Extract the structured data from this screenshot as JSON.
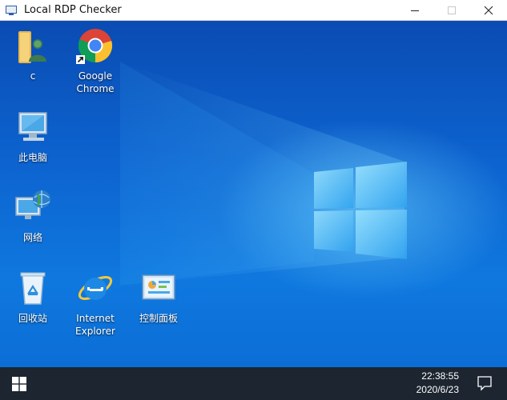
{
  "window": {
    "title": "Local RDP Checker",
    "controls": {
      "minimize": "minimize",
      "maximize": "maximize",
      "close": "×"
    }
  },
  "desktop": {
    "icons": [
      {
        "id": "user-folder",
        "label": "c",
        "icon": "user-folder-icon"
      },
      {
        "id": "google-chrome",
        "label": "Google\nChrome",
        "icon": "chrome-icon"
      },
      {
        "id": "this-pc",
        "label": "此电脑",
        "icon": "computer-icon"
      },
      {
        "id": "network",
        "label": "网络",
        "icon": "network-icon"
      },
      {
        "id": "recycle-bin",
        "label": "回收站",
        "icon": "recycle-bin-icon"
      },
      {
        "id": "internet-explorer",
        "label": "Internet\nExplorer",
        "icon": "internet-explorer-icon"
      },
      {
        "id": "control-panel",
        "label": "控制面板",
        "icon": "control-panel-icon"
      }
    ]
  },
  "taskbar": {
    "time": "22:38:55",
    "date": "2020/6/23",
    "start_icon": "windows-logo-icon",
    "notification_icon": "action-center-icon"
  },
  "colors": {
    "desktop_blue": "#0b63cf",
    "taskbar": "#1c2530",
    "window_titlebar": "#ffffff"
  }
}
